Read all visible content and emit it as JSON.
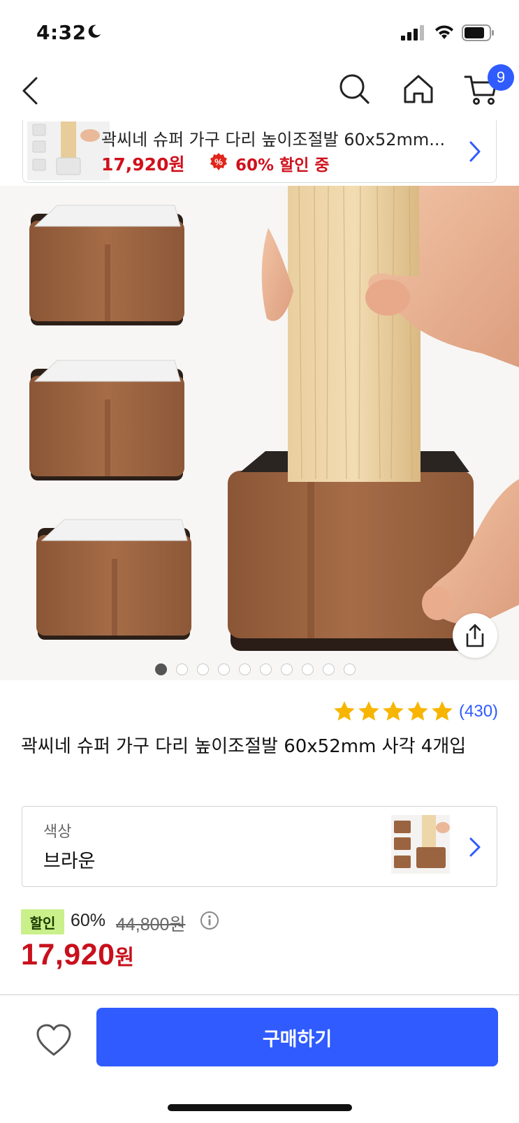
{
  "status_bar": {
    "time": "4:32",
    "icons": [
      "moon-icon",
      "cellular-signal-icon",
      "wifi-icon",
      "battery-icon"
    ]
  },
  "nav": {
    "icons": [
      "back-chevron-icon",
      "search-icon",
      "home-icon",
      "cart-icon"
    ],
    "cart_count": "9"
  },
  "mini_banner": {
    "title": "곽씨네 슈퍼 가구 다리 높이조절발 60x52mm...",
    "price": "17,920원",
    "discount_text": "60% 할인 중",
    "discount_icon_label": "%"
  },
  "gallery": {
    "image_count": 10,
    "active_index": 0,
    "share_icon": "share-icon"
  },
  "product": {
    "rating": 5,
    "review_count": "(430)",
    "title": "곽씨네 슈퍼 가구 다리 높이조절발 60x52mm 사각 4개입"
  },
  "option": {
    "label": "색상",
    "value": "브라운"
  },
  "price": {
    "badge": "할인",
    "rate": "60%",
    "original": "44,800원",
    "sale_number": "17,920",
    "sale_unit": "원"
  },
  "bottom_bar": {
    "buy_label": "구매하기",
    "wish_icon": "heart-icon"
  },
  "colors": {
    "accent_blue": "#2f5bff",
    "price_red": "#c8101c",
    "discount_green": "#c9f08a",
    "star_yellow": "#f7b500",
    "product_brown": "#9b6440"
  }
}
